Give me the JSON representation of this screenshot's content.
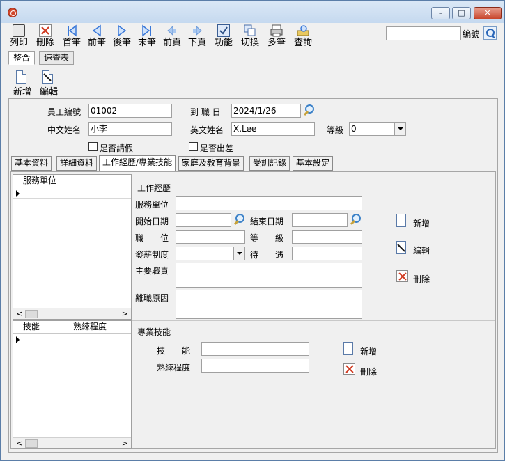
{
  "toolbar": {
    "print": "列印",
    "delete": "刪除",
    "first": "首筆",
    "prev": "前筆",
    "next": "後筆",
    "last": "末筆",
    "prev_page": "前頁",
    "next_page": "下頁",
    "function": "功能",
    "switch": "切換",
    "multi": "多筆",
    "query": "查詢"
  },
  "search": {
    "value": "",
    "label": "編號"
  },
  "view_tabs": {
    "combined": "整合",
    "quick_table": "速查表"
  },
  "sub_toolbar": {
    "add": "新增",
    "edit": "編輯"
  },
  "header": {
    "employee_id_label": "員工編號",
    "employee_id": "01002",
    "hire_date_label": "到 職 日",
    "hire_date": "2024/1/26",
    "chinese_name_label": "中文姓名",
    "chinese_name": "小李",
    "english_name_label": "英文姓名",
    "english_name": "X.Lee",
    "grade_label": "等級",
    "grade": "0",
    "on_leave_label": "是否請假",
    "on_business_trip_label": "是否出差"
  },
  "detail_tabs": [
    "基本資料",
    "詳細資料",
    "工作經歷/專業技能",
    "家庭及教育背景",
    "受訓記錄",
    "基本設定"
  ],
  "work_history": {
    "grid_header": "服務單位",
    "section_title": "工作經歷",
    "unit_label": "服務單位",
    "start_date_label": "開始日期",
    "end_date_label": "結束日期",
    "position_label": "職　　位",
    "level_label": "等　　級",
    "pay_system_label": "發薪制度",
    "treatment_label": "待　　遇",
    "duties_label": "主要職責",
    "leave_reason_label": "離職原因",
    "add": "新增",
    "edit": "編輯",
    "delete": "刪除"
  },
  "skills": {
    "grid_headers": [
      "技能",
      "熟練程度"
    ],
    "section_title": "專業技能",
    "skill_label": "技　　能",
    "proficiency_label": "熟練程度",
    "add": "新增",
    "delete": "刪除"
  }
}
